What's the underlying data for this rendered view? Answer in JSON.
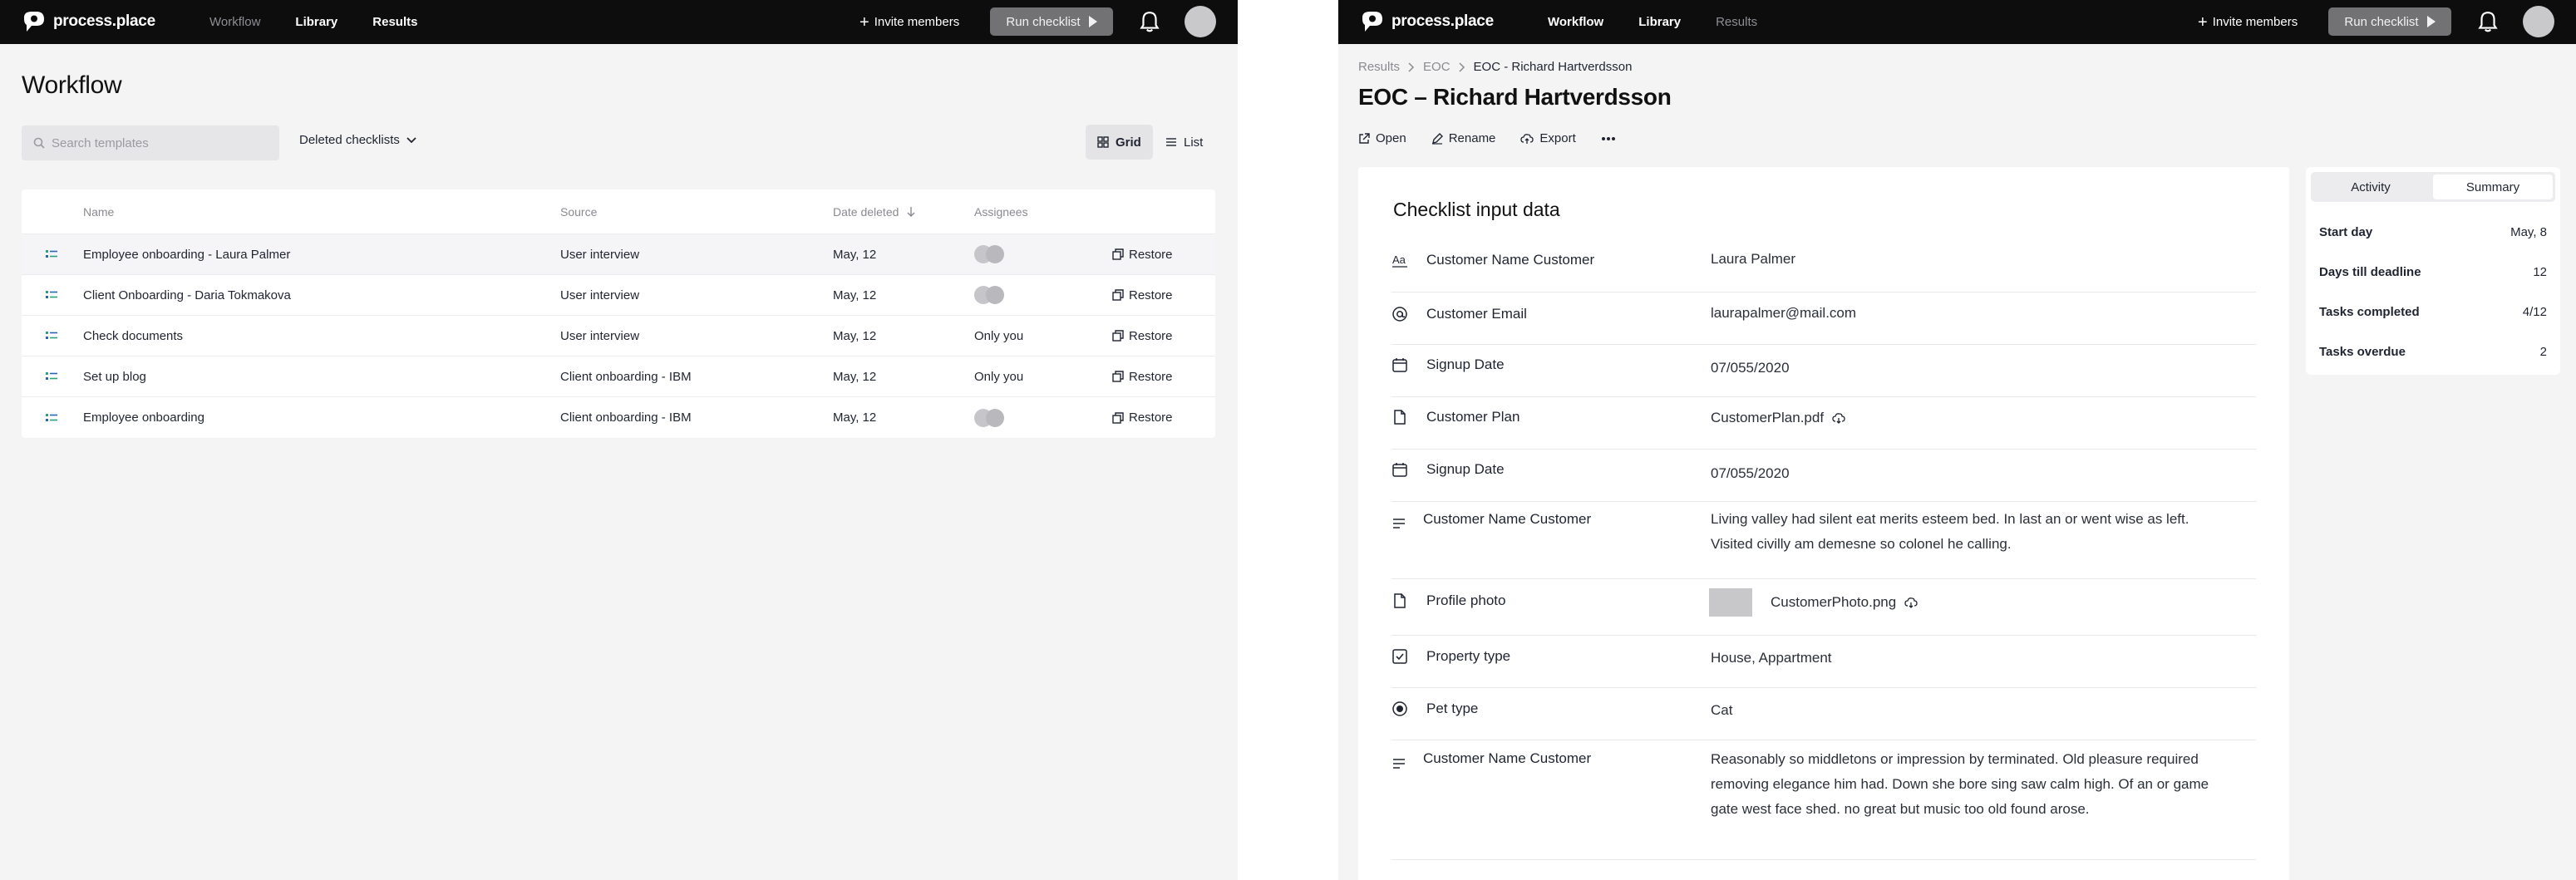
{
  "brand": {
    "name": "process.place"
  },
  "left": {
    "nav": [
      "Workflow",
      "Library",
      "Results"
    ],
    "invite_label": "Invite members",
    "run_label": "Run checklist",
    "title": "Workflow",
    "search_placeholder": "Search templates",
    "filter_label": "Deleted checklists",
    "view_grid": "Grid",
    "view_list": "List",
    "columns": {
      "name": "Name",
      "source": "Source",
      "date": "Date deleted",
      "assignees": "Assignees"
    },
    "restore_label": "Restore",
    "rows": [
      {
        "name": "Employee onboarding - Laura Palmer",
        "source": "User interview",
        "date": "May, 12",
        "assignees": ""
      },
      {
        "name": "Client Onboarding - Daria Tokmakova",
        "source": "User interview",
        "date": "May, 12",
        "assignees": ""
      },
      {
        "name": "Check documents",
        "source": "User interview",
        "date": "May, 12",
        "assignees": "Only you"
      },
      {
        "name": "Set up blog",
        "source": "Client onboarding - IBM",
        "date": "May, 12",
        "assignees": "Only you"
      },
      {
        "name": "Employee onboarding",
        "source": "Client onboarding - IBM",
        "date": "May, 12",
        "assignees": ""
      }
    ]
  },
  "right": {
    "nav": [
      "Workflow",
      "Library",
      "Results"
    ],
    "invite_label": "Invite members",
    "run_label": "Run checklist",
    "breadcrumb": [
      "Results",
      "EOC",
      "EOC - Richard Hartverdsson"
    ],
    "title": "EOC – Richard Hartverdsson",
    "actions": [
      "Open",
      "Rename",
      "Export"
    ],
    "card_title": "Checklist input data",
    "fields": [
      {
        "icon": "text-icon",
        "label": "Customer Name Customer",
        "value": "Laura Palmer"
      },
      {
        "icon": "at-icon",
        "label": "Customer Email",
        "value": "laurapalmer@mail.com"
      },
      {
        "icon": "calendar-icon",
        "label": "Signup Date",
        "value": "07/055/2020"
      },
      {
        "icon": "file-icon",
        "label": "Customer Plan",
        "value": "CustomerPlan.pdf"
      },
      {
        "icon": "calendar-icon",
        "label": "Signup Date",
        "value": "07/055/2020"
      },
      {
        "icon": "paragraph-icon",
        "label": "Customer Name Customer",
        "value": "Living valley had silent eat merits esteem bed. In last an or went wise as left. Visited civilly am demesne so colonel he calling."
      },
      {
        "icon": "file-icon",
        "label": "Profile photo",
        "value": "CustomerPhoto.png"
      },
      {
        "icon": "checkbox-icon",
        "label": "Property type",
        "value": "House, Appartment"
      },
      {
        "icon": "radio-icon",
        "label": "Pet type",
        "value": "Cat"
      },
      {
        "icon": "paragraph-icon",
        "label": "Customer Name Customer",
        "value": "Reasonably so middletons or impression by terminated. Old pleasure required removing elegance him had. Down she bore sing saw calm high. Of an or game gate west face shed. no great but music too old found arose."
      }
    ],
    "tabs": [
      "Activity",
      "Summary"
    ],
    "summary": [
      {
        "k": "Start day",
        "v": "May, 8"
      },
      {
        "k": "Days till deadline",
        "v": "12"
      },
      {
        "k": "Tasks completed",
        "v": "4/12"
      },
      {
        "k": "Tasks overdue",
        "v": "2"
      }
    ]
  }
}
